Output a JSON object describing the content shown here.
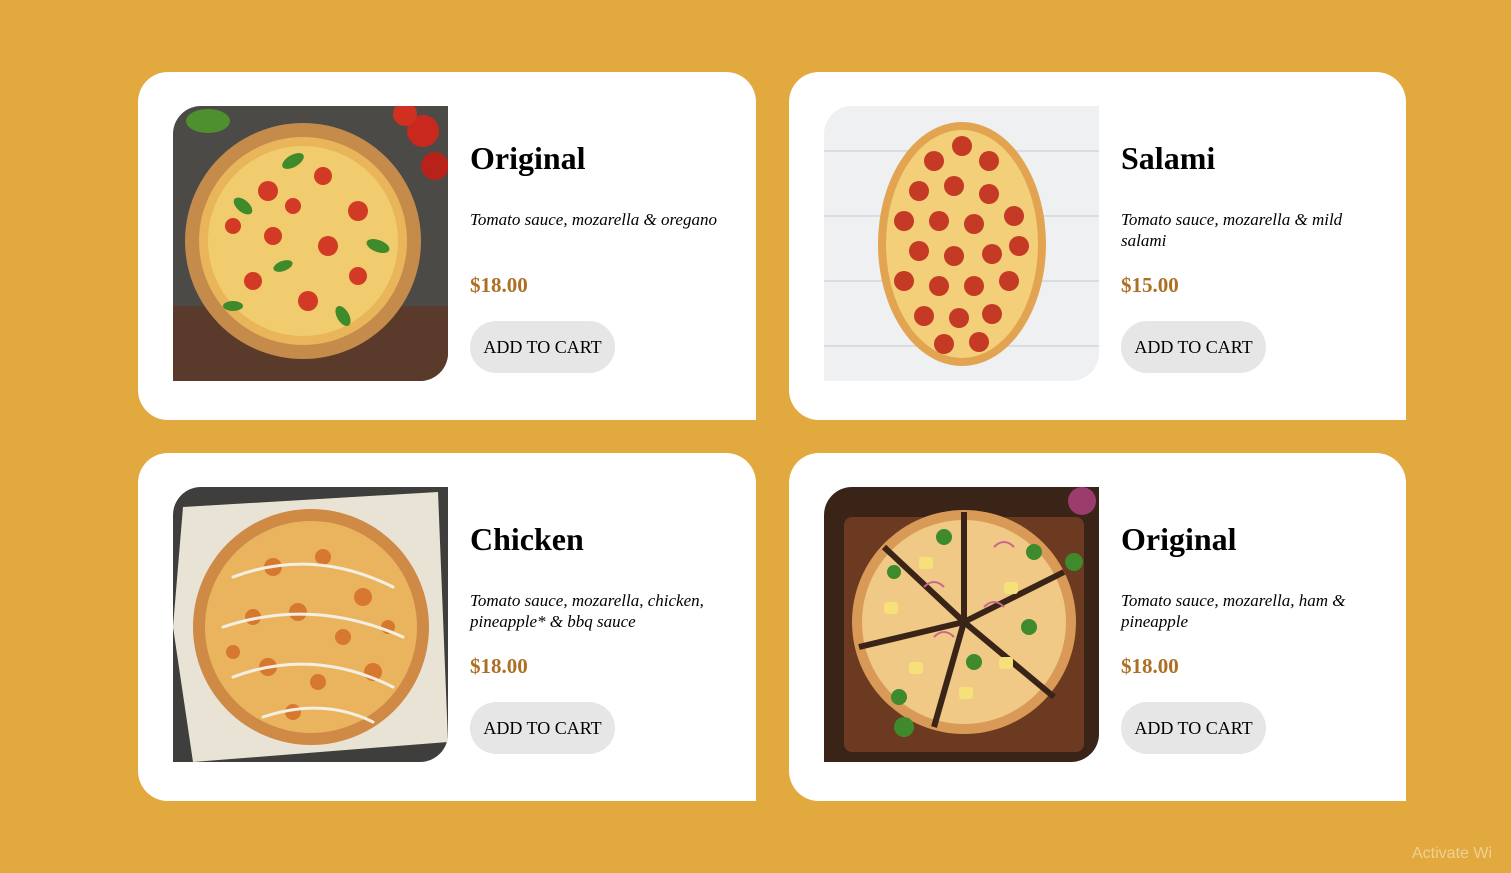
{
  "colors": {
    "background": "#e2a93e",
    "card": "#ffffff",
    "price": "#ad6f24",
    "button": "#e6e6e6"
  },
  "products": [
    {
      "title": "Original",
      "description": "Tomato sauce, mozarella & oregano",
      "price": "$18.00",
      "button_label": "ADD TO CART",
      "image": "margherita-pizza-image"
    },
    {
      "title": "Salami",
      "description": "Tomato sauce, mozarella & mild salami",
      "price": "$15.00",
      "button_label": "ADD TO CART",
      "image": "pepperoni-pizza-image"
    },
    {
      "title": "Chicken",
      "description": "Tomato sauce, mozarella, chicken, pineapple* & bbq sauce",
      "price": "$18.00",
      "button_label": "ADD TO CART",
      "image": "chicken-bbq-pizza-image"
    },
    {
      "title": "Original",
      "description": "Tomato sauce, mozarella, ham & pineapple",
      "price": "$18.00",
      "button_label": "ADD TO CART",
      "image": "hawaiian-pizza-image"
    }
  ],
  "watermark": "Activate Wi"
}
